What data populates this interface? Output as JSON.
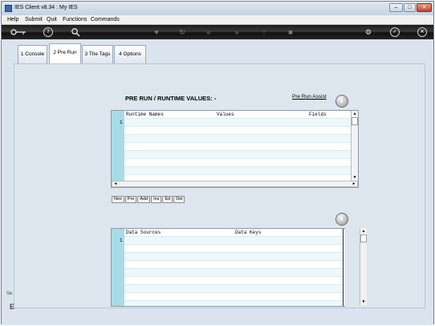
{
  "window": {
    "title": "IES Client v8.34 : My IES",
    "controls": [
      "–",
      "□",
      "✕"
    ]
  },
  "menu": [
    "Help",
    "Submit",
    "Quit",
    "Functions",
    "Commands"
  ],
  "toolbar_icons": [
    "key-icon",
    "help-icon",
    "search-icon",
    "heart-icon",
    "refresh-icon",
    "rewind-icon",
    "fast-forward-icon",
    "upload-icon",
    "stop-icon",
    "settings-icon",
    "check-icon",
    "close-icon"
  ],
  "tabs": [
    {
      "label": "1 Console",
      "active": false
    },
    {
      "label": "2 Pre Run",
      "active": true
    },
    {
      "label": "3 The Tags",
      "active": false
    },
    {
      "label": "4 Options",
      "active": false
    }
  ],
  "section": {
    "title": "PRE RUN / RUNTIME VALUES: -",
    "assist_link": "Pre Run Assist"
  },
  "runtime_grid": {
    "headers": [
      "Runtime Names",
      "Values",
      "Fields"
    ],
    "first_row_number": "1",
    "buttons": [
      "Nex",
      "Pre",
      "Add",
      "Ins",
      "Ed",
      "Del"
    ]
  },
  "data_grid": {
    "headers": [
      "Data Sources",
      "Data Keys"
    ],
    "first_row_number": "1"
  },
  "left_strip": {
    "text1": "Se",
    "text2": "E"
  }
}
